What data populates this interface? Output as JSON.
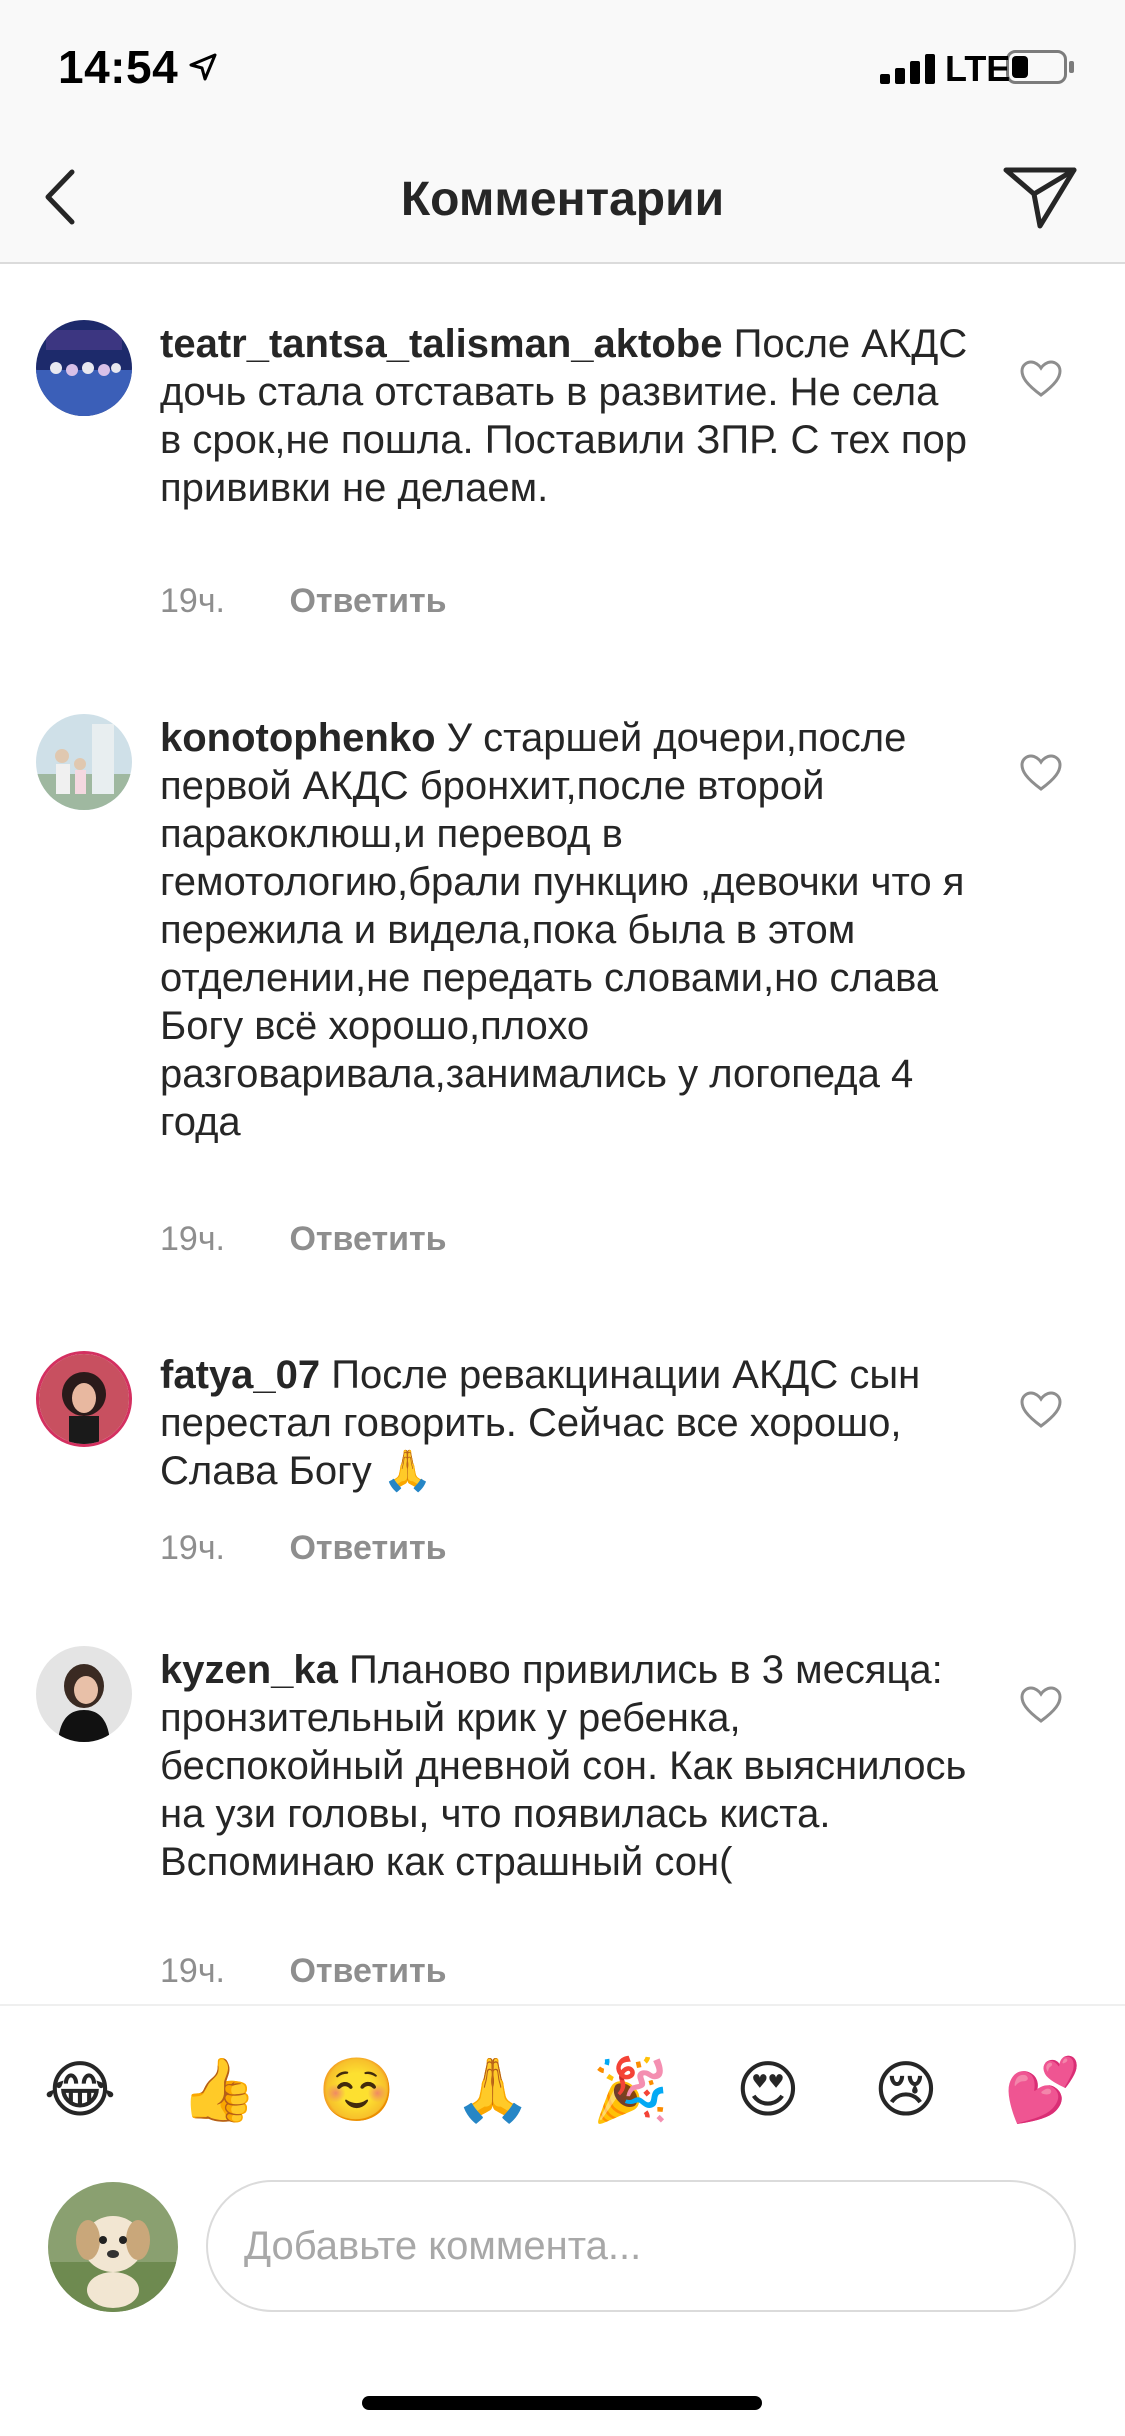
{
  "status_bar": {
    "time": "14:54",
    "network": "LTE"
  },
  "nav": {
    "title": "Комментарии",
    "back_icon": "chevron-left-icon",
    "direct_icon": "paper-plane-icon"
  },
  "comments": [
    {
      "username": "teatr_tantsa_talisman_aktobe",
      "text": "После АКДС дочь стала отставать в развитие. Не села в срок,не пошла. Поставили ЗПР. С тех пор прививки не делаем.",
      "time": "19ч.",
      "reply_label": "Ответить"
    },
    {
      "username": "konotophenko",
      "text": "У старшей дочери,после первой АКДС бронхит,после второй паракоклюш,и перевод в гемотологию,брали пункцию ,девочки что я пережила и видела,пока была в этом отделении,не передать словами,но слава Богу всё хорошо,плохо разговаривала,занимались у логопеда 4 года",
      "time": "19ч.",
      "reply_label": "Ответить"
    },
    {
      "username": "fatya_07",
      "text": "После ревакцинации АКДС сын перестал говорить. Сейчас все хорошо, Слава Богу 🙏",
      "time": "19ч.",
      "reply_label": "Ответить"
    },
    {
      "username": "kyzen_ka",
      "text": "Планово привились в 3 месяца: пронзительный крик у ребенка, беспокойный дневной сон. Как выяснилось на узи головы, что появилась киста. Вспоминаю как страшный сон(",
      "time": "19ч.",
      "reply_label": "Ответить"
    }
  ],
  "emoji_bar": [
    "😂",
    "👍",
    "☺️",
    "🙏",
    "🎉",
    "😍",
    "😢",
    "💕"
  ],
  "input": {
    "placeholder": "Добавьте коммента..."
  },
  "colors": {
    "text": "#262626",
    "secondary": "#8e8e8e",
    "divider": "#dbdbdb",
    "bar_bg": "#f9f9f9"
  }
}
